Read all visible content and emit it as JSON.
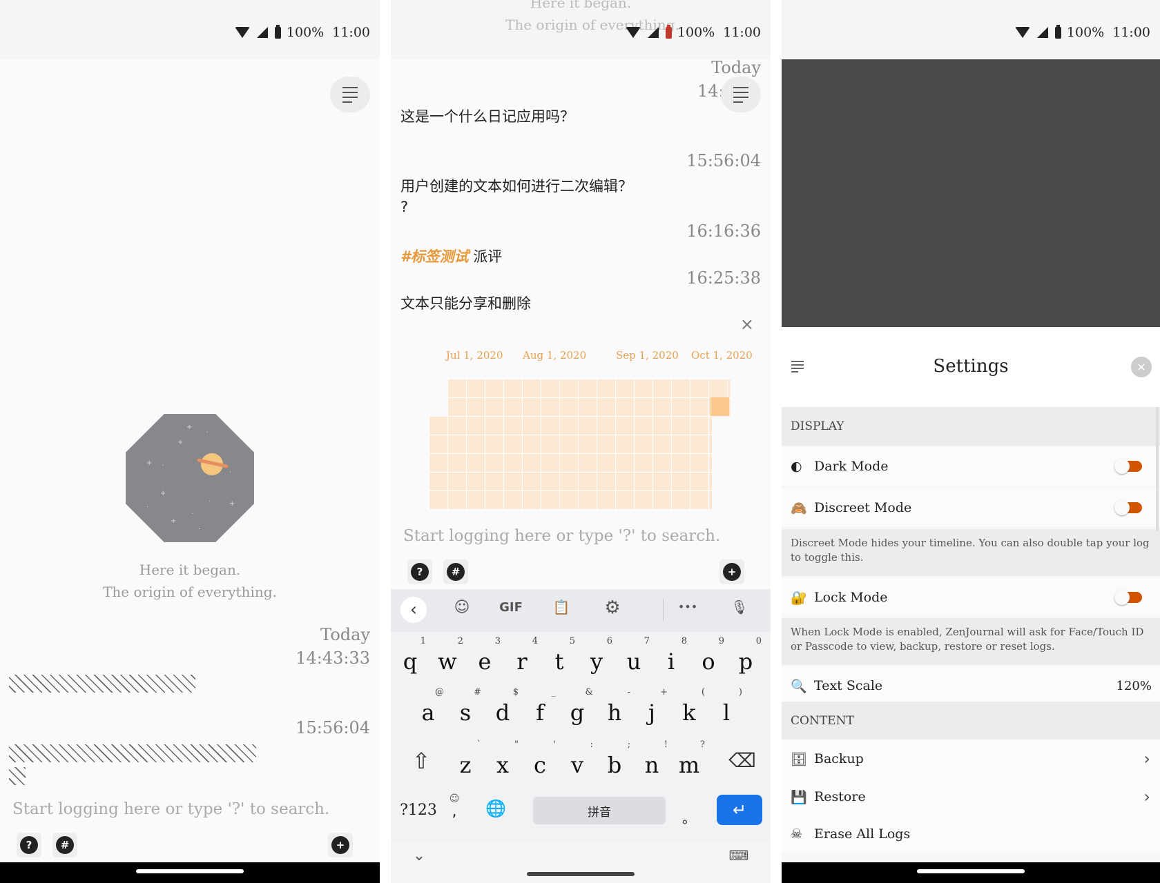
{
  "status": {
    "battery": "100%",
    "time": "11:00"
  },
  "panel1": {
    "origin_line1": "Here it began.",
    "origin_line2": "The origin of everything.",
    "day_label": "Today",
    "time1": "14:43:33",
    "time2": "15:56:04",
    "input_placeholder": "Start logging here or type '?' to search.",
    "help_label": "?",
    "tag_label": "#",
    "add_label": "+"
  },
  "panel2": {
    "ghost_line1": "Here it began.",
    "ghost_line2": "The origin of everything.",
    "day_label": "Today",
    "time_partial": "14:",
    "entries": [
      {
        "text": "这是一个什么日记应用吗？"
      },
      {
        "time": "15:56:04",
        "text": "用户创建的文本如何进行二次编辑？",
        "text2": "?"
      },
      {
        "time": "16:16:36",
        "tag": "#标签测试",
        "text": "派评"
      },
      {
        "time": "16:25:38",
        "text": "文本只能分享和删除"
      }
    ],
    "close_label": "×",
    "heatmap_months": [
      "Jul 1, 2020",
      "Aug 1, 2020",
      "Sep 1, 2020",
      "Oct 1, 2020"
    ],
    "input_placeholder": "Start logging here or type '?' to search.",
    "help_label": "?",
    "tag_label": "#",
    "add_label": "+",
    "keyboard": {
      "toolbar": {
        "back": "‹",
        "sticker": "☺",
        "gif": "GIF",
        "clipboard": "📋",
        "settings": "⚙",
        "more": "•••",
        "mic": "🎙"
      },
      "row1": [
        [
          "q",
          "1"
        ],
        [
          "w",
          "2"
        ],
        [
          "e",
          "3"
        ],
        [
          "r",
          "4"
        ],
        [
          "t",
          "5"
        ],
        [
          "y",
          "6"
        ],
        [
          "u",
          "7"
        ],
        [
          "i",
          "8"
        ],
        [
          "o",
          "9"
        ],
        [
          "p",
          "0"
        ]
      ],
      "row2": [
        [
          "a",
          "@"
        ],
        [
          "s",
          "#"
        ],
        [
          "d",
          "$"
        ],
        [
          "f",
          "_"
        ],
        [
          "g",
          "&"
        ],
        [
          "h",
          "-"
        ],
        [
          "j",
          "+"
        ],
        [
          "k",
          "("
        ],
        [
          "l",
          ")"
        ]
      ],
      "row3": [
        [
          "z",
          "`"
        ],
        [
          "x",
          "\""
        ],
        [
          "c",
          "'"
        ],
        [
          "v",
          ":"
        ],
        [
          "b",
          ";"
        ],
        [
          "n",
          "!"
        ],
        [
          "m",
          "?"
        ]
      ],
      "shift": "⇧",
      "backspace": "⌫",
      "symbols": "?123",
      "comma": ",",
      "emoji": "☺",
      "globe": "🌐",
      "space": "拼音",
      "period": "。",
      "enter": "↵",
      "hide": "⌄",
      "keyboard_icon": "⌨"
    }
  },
  "panel3": {
    "title": "Settings",
    "close_label": "✕",
    "display_header": "DISPLAY",
    "dark_mode": "Dark Mode",
    "discreet_mode": "Discreet Mode",
    "discreet_desc": "Discreet Mode hides your timeline. You can also double tap your log to toggle this.",
    "lock_mode": "Lock Mode",
    "lock_desc": "When Lock Mode is enabled, ZenJournal will ask for Face/Touch ID or Passcode to view, backup, restore or reset logs.",
    "text_scale": "Text Scale",
    "text_scale_value": "120%",
    "content_header": "CONTENT",
    "backup": "Backup",
    "restore": "Restore",
    "erase": "Erase All Logs",
    "icons": {
      "dark": "◐",
      "discreet": "🙈",
      "lock": "🔐",
      "scale": "🔍",
      "backup": "🗄",
      "restore": "💾",
      "erase": "☠"
    },
    "accent_color": "#d35400"
  }
}
